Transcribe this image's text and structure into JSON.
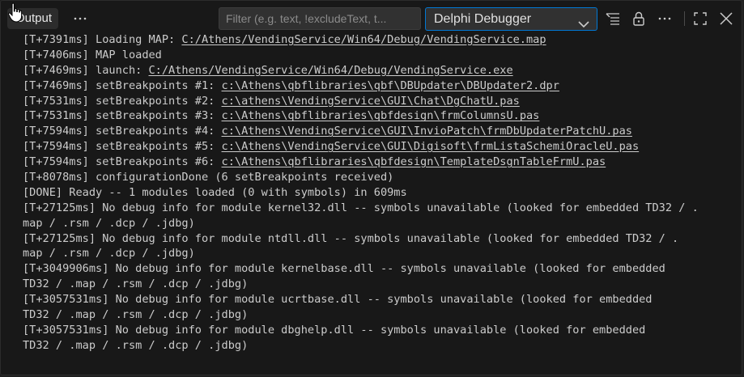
{
  "toolbar": {
    "tab_label": "Output",
    "more_label": "···",
    "filter": {
      "placeholder": "Filter (e.g. text, !excludeText, t...",
      "value": ""
    },
    "channel": {
      "selected": "Delphi Debugger"
    },
    "icons": {
      "more": "ellipsis-icon",
      "channel_chevron": "chevron-down-icon",
      "word_wrap": "word-wrap-icon",
      "lock": "lock-icon",
      "panel_more": "ellipsis-icon",
      "maximize": "maximize-icon",
      "close": "close-icon"
    }
  },
  "log": [
    {
      "text": "[T+7391ms] Loading MAP: ",
      "path": "C:/Athens/VendingService/Win64/Debug/VendingService.map"
    },
    {
      "text": "[T+7406ms] MAP loaded",
      "path": ""
    },
    {
      "text": "[T+7469ms] launch: ",
      "path": "C:/Athens/VendingService/Win64/Debug/VendingService.exe"
    },
    {
      "text": "[T+7469ms] setBreakpoints #1: ",
      "path": "c:\\Athens\\qbflibraries\\qbf\\DBUpdater\\DBUpdater2.dpr"
    },
    {
      "text": "[T+7531ms] setBreakpoints #2: ",
      "path": "c:\\athens\\VendingService\\GUI\\Chat\\DgChatU.pas"
    },
    {
      "text": "[T+7531ms] setBreakpoints #3: ",
      "path": "c:\\Athens\\qbflibraries\\qbfdesign\\frmColumnsU.pas"
    },
    {
      "text": "[T+7594ms] setBreakpoints #4: ",
      "path": "c:\\Athens\\VendingService\\GUI\\InvioPatch\\frmDbUpdaterPatchU.pas"
    },
    {
      "text": "[T+7594ms] setBreakpoints #5: ",
      "path": "c:\\Athens\\VendingService\\GUI\\Digisoft\\frmListaSchemiOracleU.pas"
    },
    {
      "text": "[T+7594ms] setBreakpoints #6: ",
      "path": "c:\\Athens\\qbflibraries\\qbfdesign\\TemplateDsgnTableFrmU.pas"
    },
    {
      "text": "[T+8078ms] configurationDone (6 setBreakpoints received)",
      "path": ""
    },
    {
      "text": "[DONE] Ready -- 1 modules loaded (0 with symbols) in 609ms",
      "path": ""
    },
    {
      "text": "[T+27125ms] No debug info for module kernel32.dll -- symbols unavailable (looked for embedded TD32 / .",
      "path": ""
    },
    {
      "text": "map / .rsm / .dcp / .jdbg)",
      "path": ""
    },
    {
      "text": "[T+27125ms] No debug info for module ntdll.dll -- symbols unavailable (looked for embedded TD32 / .",
      "path": ""
    },
    {
      "text": "map / .rsm / .dcp / .jdbg)",
      "path": ""
    },
    {
      "text": "[T+3049906ms] No debug info for module kernelbase.dll -- symbols unavailable (looked for embedded",
      "path": ""
    },
    {
      "text": "TD32 / .map / .rsm / .dcp / .jdbg)",
      "path": ""
    },
    {
      "text": "[T+3057531ms] No debug info for module ucrtbase.dll -- symbols unavailable (looked for embedded",
      "path": ""
    },
    {
      "text": "TD32 / .map / .rsm / .dcp / .jdbg)",
      "path": ""
    },
    {
      "text": "[T+3057531ms] No debug info for module dbghelp.dll -- symbols unavailable (looked for embedded",
      "path": ""
    },
    {
      "text": "TD32 / .map / .rsm / .dcp / .jdbg)",
      "path": ""
    }
  ]
}
